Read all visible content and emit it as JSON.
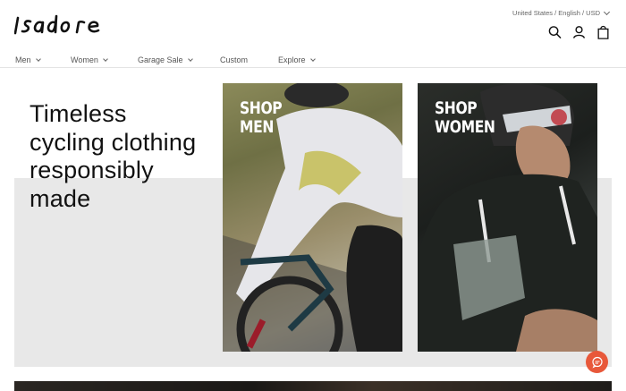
{
  "brand": {
    "name": "Isadore",
    "logo_icon": "isadore-wordmark"
  },
  "header": {
    "locale_label": "United States / English / USD",
    "tools": [
      {
        "name": "search",
        "icon": "search-icon"
      },
      {
        "name": "account",
        "icon": "user-icon"
      },
      {
        "name": "cart",
        "icon": "shopping-bag-icon"
      }
    ]
  },
  "nav": {
    "items": [
      {
        "label": "Men",
        "has_dropdown": true
      },
      {
        "label": "Women",
        "has_dropdown": true
      },
      {
        "label": "Garage Sale",
        "has_dropdown": true
      },
      {
        "label": "Custom",
        "has_dropdown": false
      },
      {
        "label": "Explore",
        "has_dropdown": true
      }
    ]
  },
  "hero": {
    "headline": "Timeless cycling clothing responsibly made",
    "cards": [
      {
        "label": "SHOP\nMEN"
      },
      {
        "label": "SHOP\nWOMEN"
      }
    ]
  },
  "chat": {
    "icon": "chat-bubble-icon",
    "color": "#e8583a"
  },
  "colors": {
    "background": "#ffffff",
    "band": "#e8e8e8",
    "text": "#111111",
    "nav_text": "#555555"
  }
}
